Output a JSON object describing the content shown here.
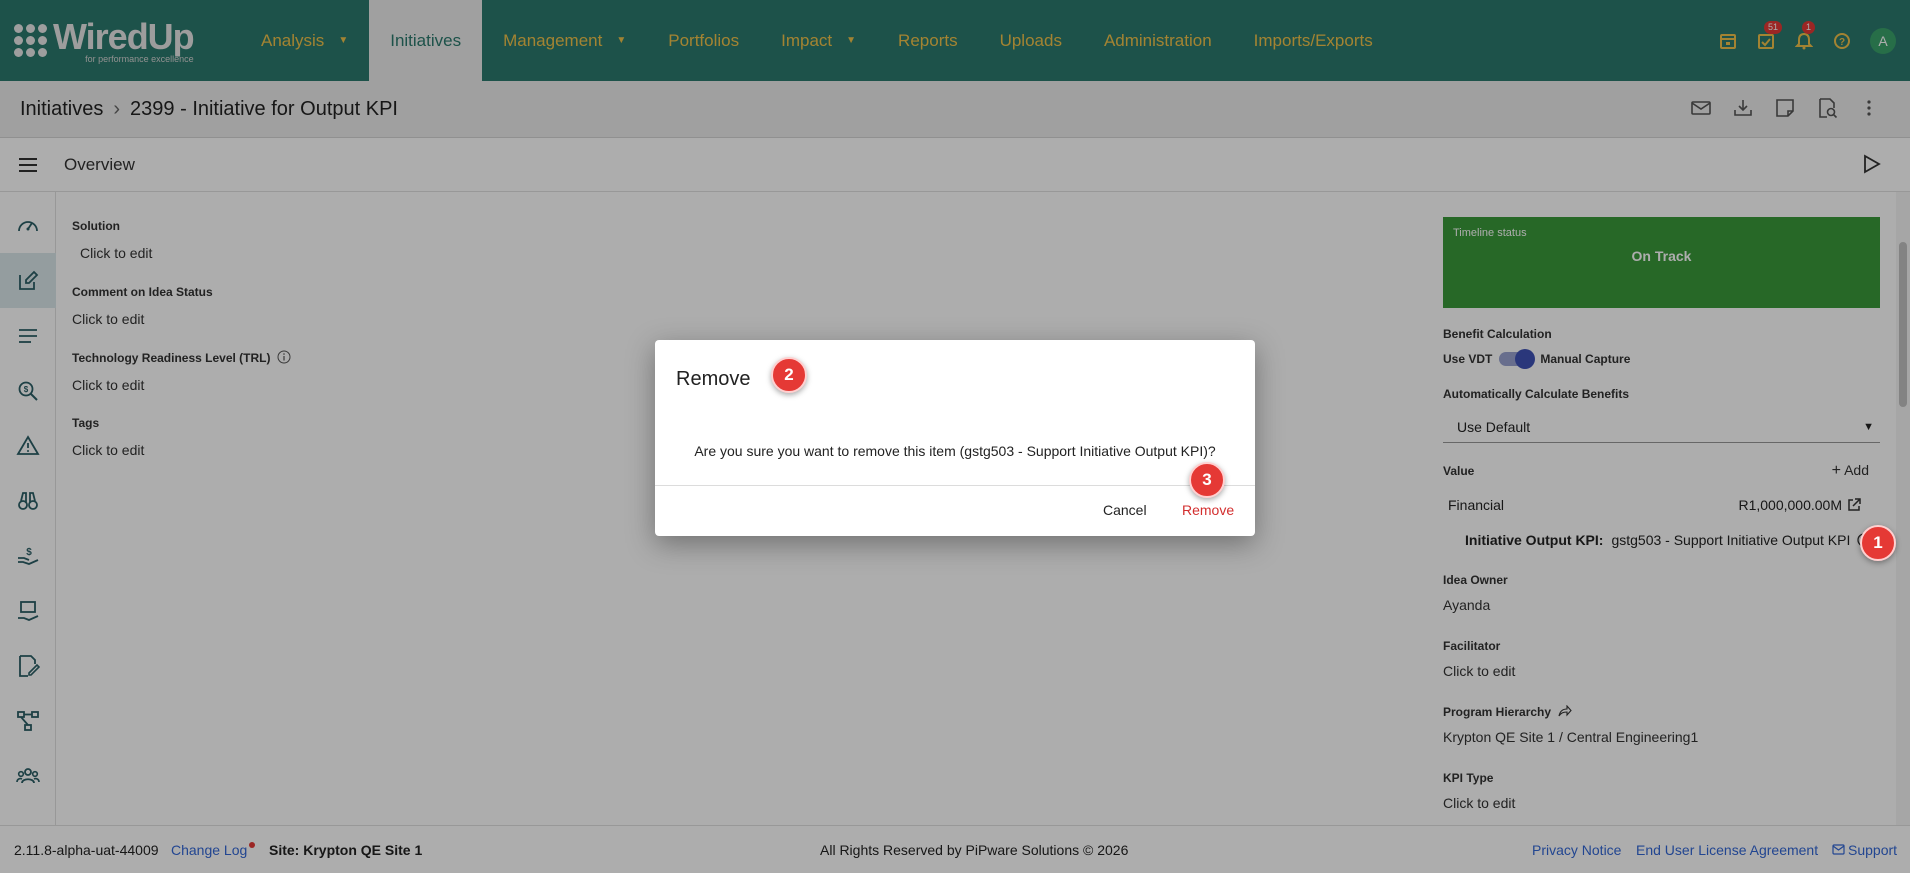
{
  "logo": {
    "name": "WiredUp",
    "tagline": "for performance excellence"
  },
  "nav": {
    "items": [
      {
        "label": "Analysis",
        "dropdown": true
      },
      {
        "label": "Initiatives",
        "active": true
      },
      {
        "label": "Management",
        "dropdown": true
      },
      {
        "label": "Portfolios"
      },
      {
        "label": "Impact",
        "dropdown": true
      },
      {
        "label": "Reports"
      },
      {
        "label": "Uploads"
      },
      {
        "label": "Administration"
      },
      {
        "label": "Imports/Exports"
      }
    ],
    "tasks_badge": "51",
    "notifications_badge": "1",
    "avatar_initial": "A"
  },
  "breadcrumb": {
    "root": "Initiatives",
    "current": "2399 - Initiative for Output KPI"
  },
  "overview": {
    "title": "Overview"
  },
  "fields": {
    "solution": {
      "label": "Solution",
      "value": "Click to edit"
    },
    "comment": {
      "label": "Comment on Idea Status",
      "value": "Click to edit"
    },
    "trl": {
      "label": "Technology Readiness Level (TRL)",
      "value": "Click to edit"
    },
    "tags": {
      "label": "Tags",
      "value": "Click to edit"
    }
  },
  "right_panel": {
    "timeline_label": "Timeline status",
    "timeline_value": "On Track",
    "benefit_calc_label": "Benefit Calculation",
    "use_vdt": "Use VDT",
    "manual_capture": "Manual Capture",
    "auto_calc_label": "Automatically Calculate Benefits",
    "auto_calc_value": "Use Default",
    "value_label": "Value",
    "add_label": "Add",
    "financial_label": "Financial",
    "financial_value": "R1,000,000.00M",
    "kpi_label": "Initiative Output KPI:",
    "kpi_value": "gstg503 - Support Initiative Output KPI",
    "idea_owner_label": "Idea Owner",
    "idea_owner_value": "Ayanda",
    "facilitator_label": "Facilitator",
    "facilitator_value": "Click to edit",
    "program_label": "Program Hierarchy",
    "program_value": "Krypton QE Site 1 / Central Engineering1",
    "kpi_type_label": "KPI Type",
    "kpi_type_value": "Click to edit"
  },
  "footer": {
    "version": "2.11.8-alpha-uat-44009",
    "change_log": "Change Log",
    "site": "Site: Krypton QE Site 1",
    "rights": "All Rights Reserved by PiPware Solutions © 2026",
    "privacy": "Privacy Notice",
    "eula": "End User License Agreement",
    "support": "Support"
  },
  "dialog": {
    "title": "Remove",
    "message": "Are you sure you want to remove this item (gstg503 - Support Initiative Output KPI)?",
    "cancel": "Cancel",
    "remove": "Remove"
  },
  "markers": {
    "one": "1",
    "two": "2",
    "three": "3"
  },
  "colors": {
    "nav_bg": "#2c7a6d",
    "nav_text": "#f0c24a",
    "timeline_green": "#3a9a3a",
    "marker_red": "#e53935",
    "link_blue": "#3367d6",
    "remove_red": "#d32f2f"
  }
}
